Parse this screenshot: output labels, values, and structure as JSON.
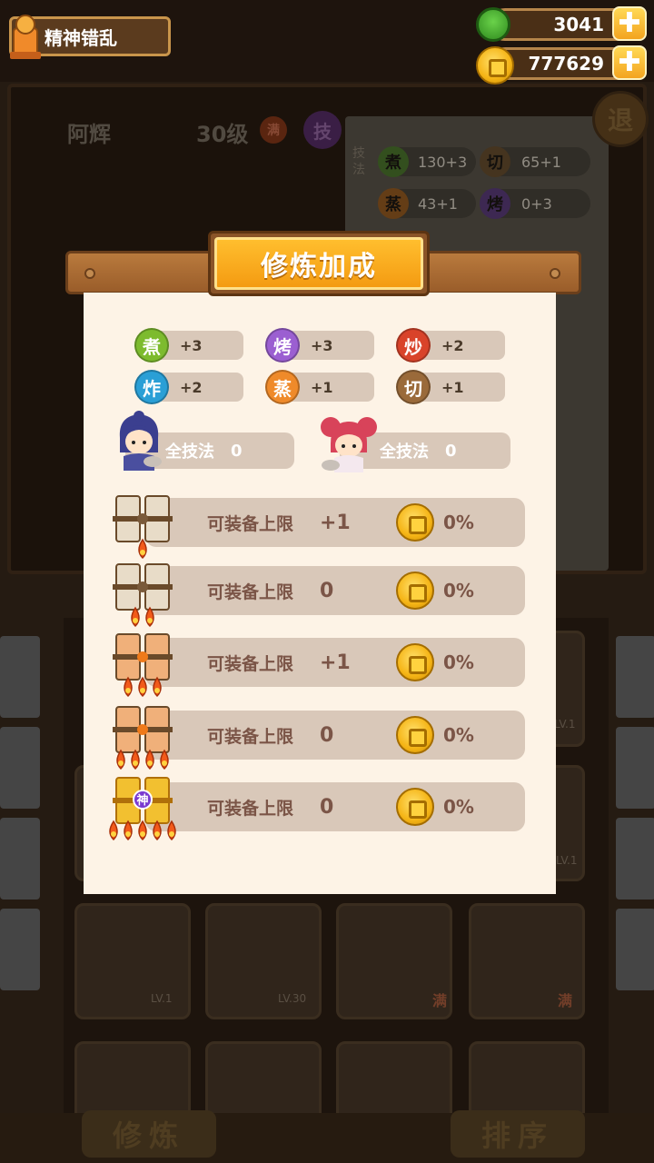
{
  "hud": {
    "player_title": "精神错乱",
    "gems": "3041",
    "coins": "777629",
    "plus_glyph": "✚"
  },
  "background": {
    "chef_name": "阿辉",
    "chef_level": "30级",
    "max_badge": "满",
    "skill_badge": "技",
    "exit_label": "退",
    "info_label": "技法",
    "stats": [
      {
        "glyph": "煮",
        "value": "130+3",
        "color": "#6a9a3a"
      },
      {
        "glyph": "切",
        "value": "65+1",
        "color": "#8a6a3a"
      },
      {
        "glyph": "蒸",
        "value": "43+1",
        "color": "#c2772a"
      },
      {
        "glyph": "烤",
        "value": "0+3",
        "color": "#7a4fa0"
      }
    ],
    "grid_labels": [
      "LV.1",
      "LV.30",
      "满",
      "满",
      "LV.1",
      "LV.1"
    ],
    "bottom_left_button": "修炼",
    "bottom_right_button": "排序"
  },
  "modal": {
    "title": "修炼加成",
    "skills": [
      {
        "glyph": "煮",
        "value": "+3",
        "color": "#7dbb2e"
      },
      {
        "glyph": "烤",
        "value": "+3",
        "color": "#9b5fd1"
      },
      {
        "glyph": "炒",
        "value": "+2",
        "color": "#d9432a"
      },
      {
        "glyph": "炸",
        "value": "+2",
        "color": "#2a9fd6"
      },
      {
        "glyph": "蒸",
        "value": "+1",
        "color": "#ef8a2a"
      },
      {
        "glyph": "切",
        "value": "+1",
        "color": "#9a6a3a"
      }
    ],
    "all_skill": [
      {
        "label": "全技法",
        "value": "0"
      },
      {
        "label": "全技法",
        "value": "0"
      }
    ],
    "tiers": [
      {
        "label": "可装备上限",
        "value": "+1",
        "percent": "0%",
        "flames": 1,
        "divine": ""
      },
      {
        "label": "可装备上限",
        "value": "0",
        "percent": "0%",
        "flames": 2,
        "divine": ""
      },
      {
        "label": "可装备上限",
        "value": "+1",
        "percent": "0%",
        "flames": 3,
        "divine": ""
      },
      {
        "label": "可装备上限",
        "value": "0",
        "percent": "0%",
        "flames": 4,
        "divine": ""
      },
      {
        "label": "可装备上限",
        "value": "0",
        "percent": "0%",
        "flames": 5,
        "divine": "神"
      }
    ]
  }
}
